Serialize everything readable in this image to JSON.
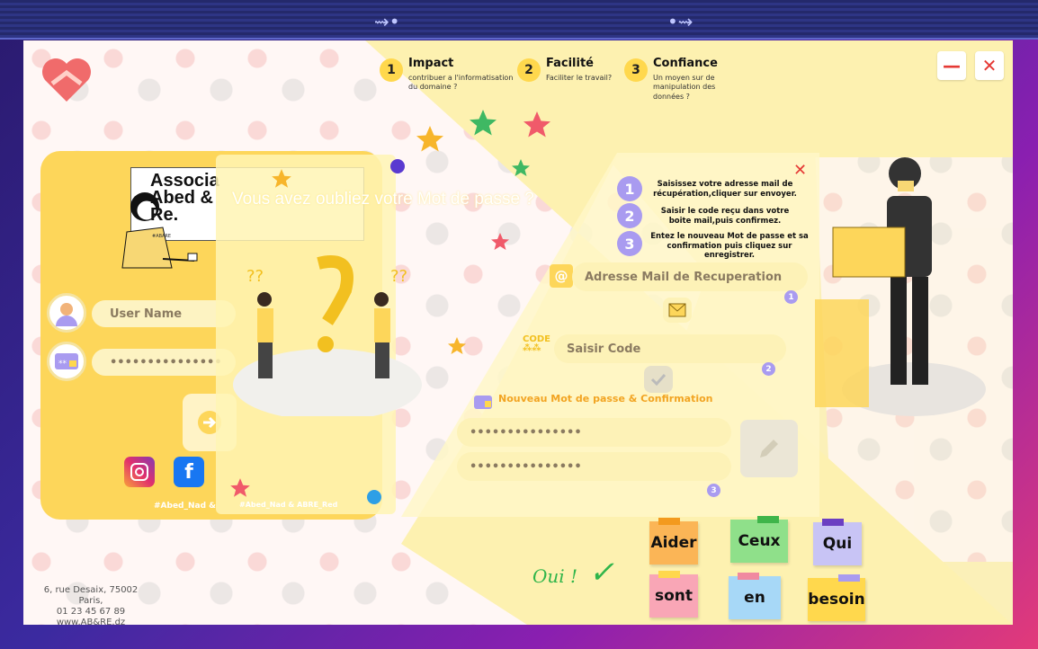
{
  "features": [
    {
      "num": "1",
      "title": "Impact",
      "subtitle": "contribuer a l'informatisation du domaine ?"
    },
    {
      "num": "2",
      "title": "Facilité",
      "subtitle": "Faciliter le travail?"
    },
    {
      "num": "3",
      "title": "Confiance",
      "subtitle": "Un moyen sur de manipulation des données ?"
    }
  ],
  "window": {
    "minimize": "—",
    "close": "✕"
  },
  "brand": {
    "line1": "Associa",
    "line2": "Abed &",
    "line3": "Re.",
    "tag": "#ABARE"
  },
  "login": {
    "username_placeholder": "User Name",
    "password_value": "•••••••••••••••",
    "hashtag": "#Abed_Nad &"
  },
  "forgot": {
    "title": "Vous avez oubliez votre Mot de passe ?",
    "hashtag": "#Abed_Nad & ABRE_Red"
  },
  "recovery": {
    "close": "✕",
    "steps": [
      {
        "num": "1",
        "text": "Saisissez votre adresse mail de récupération,cliquer sur envoyer."
      },
      {
        "num": "2",
        "text": "Saisir le code reçu dans votre boite mail,puis confirmez."
      },
      {
        "num": "3",
        "text": "Entez le nouveau Mot de passe et sa confirmation puis cliquez sur enregistrer."
      }
    ],
    "email_placeholder": "Adresse Mail de Recuperation",
    "code_placeholder": "Saisir Code",
    "code_icon_label": "CODE",
    "newpass_label": "Nouveau Mot de passe & Confirmation",
    "pass1": "•••••••••••••••",
    "pass2": "•••••••••••••••",
    "badge1": "1",
    "badge2": "2",
    "badge3": "3"
  },
  "notes": [
    {
      "text": "Aider",
      "color": "#fbb556",
      "tape": "#f39a1e"
    },
    {
      "text": "Ceux",
      "color": "#8fe08a",
      "tape": "#3fb54a"
    },
    {
      "text": "Qui",
      "color": "#c8c4f5",
      "tape": "#6b3fc2"
    },
    {
      "text": "sont",
      "color": "#f9a6b6",
      "tape": "#ffd84d"
    },
    {
      "text": "en",
      "color": "#a7d8f7",
      "tape": "#f08aa0"
    },
    {
      "text": "besoin",
      "color": "#ffd84d",
      "tape": "#a99bf0"
    }
  ],
  "oui": "Oui !",
  "address": {
    "line1": "6, rue Desaix, 75002 Paris,",
    "line2": "01 23 45 67 89",
    "line3": "www.AB&RE.dz"
  }
}
